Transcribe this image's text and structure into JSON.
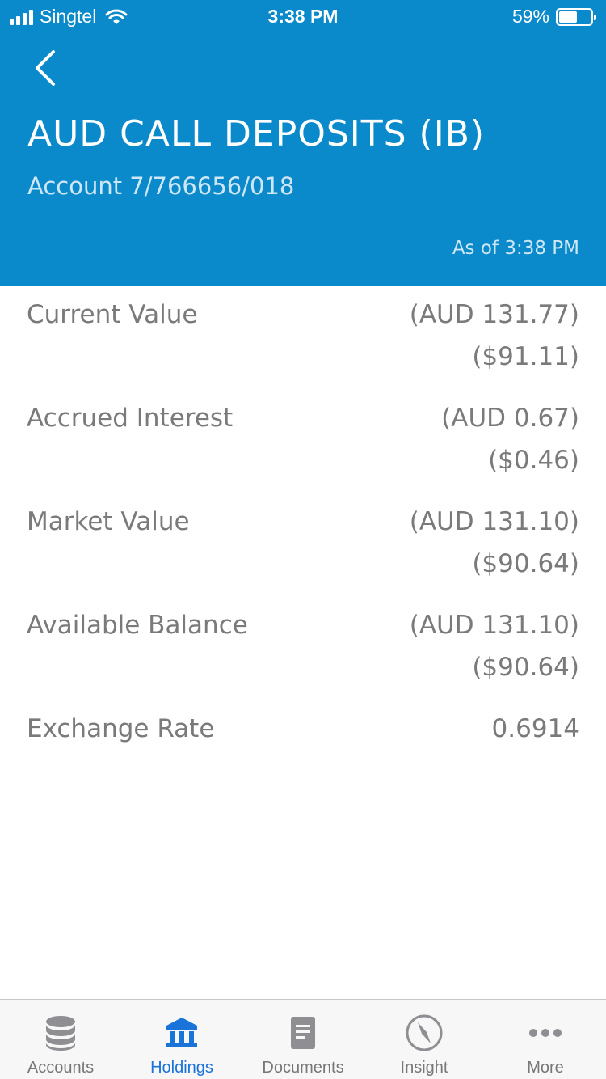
{
  "status_bar": {
    "carrier": "Singtel",
    "time": "3:38 PM",
    "battery": "59%",
    "battery_level": 0.59
  },
  "header": {
    "title": "AUD CALL DEPOSITS (IB)",
    "account": "Account 7/766656/018",
    "as_of": "As of 3:38 PM",
    "back_icon": "chevron-left-icon",
    "background_color": "#0a8acb"
  },
  "details": [
    {
      "label": "Current Value",
      "value": "(AUD 131.77)",
      "value_usd": "($91.11)"
    },
    {
      "label": "Accrued Interest",
      "value": "(AUD 0.67)",
      "value_usd": "($0.46)"
    },
    {
      "label": "Market Value",
      "value": "(AUD 131.10)",
      "value_usd": "($90.64)"
    },
    {
      "label": "Available Balance",
      "value": "(AUD 131.10)",
      "value_usd": "($90.64)"
    },
    {
      "label": "Exchange Rate",
      "value": "0.6914",
      "value_usd": ""
    }
  ],
  "tabbar": {
    "active_color": "#1a73d9",
    "items": [
      {
        "label": "Accounts",
        "icon": "database-icon"
      },
      {
        "label": "Holdings",
        "icon": "bank-icon",
        "active": true
      },
      {
        "label": "Documents",
        "icon": "document-icon"
      },
      {
        "label": "Insight",
        "icon": "compass-icon"
      },
      {
        "label": "More",
        "icon": "more-dots-icon"
      }
    ]
  }
}
